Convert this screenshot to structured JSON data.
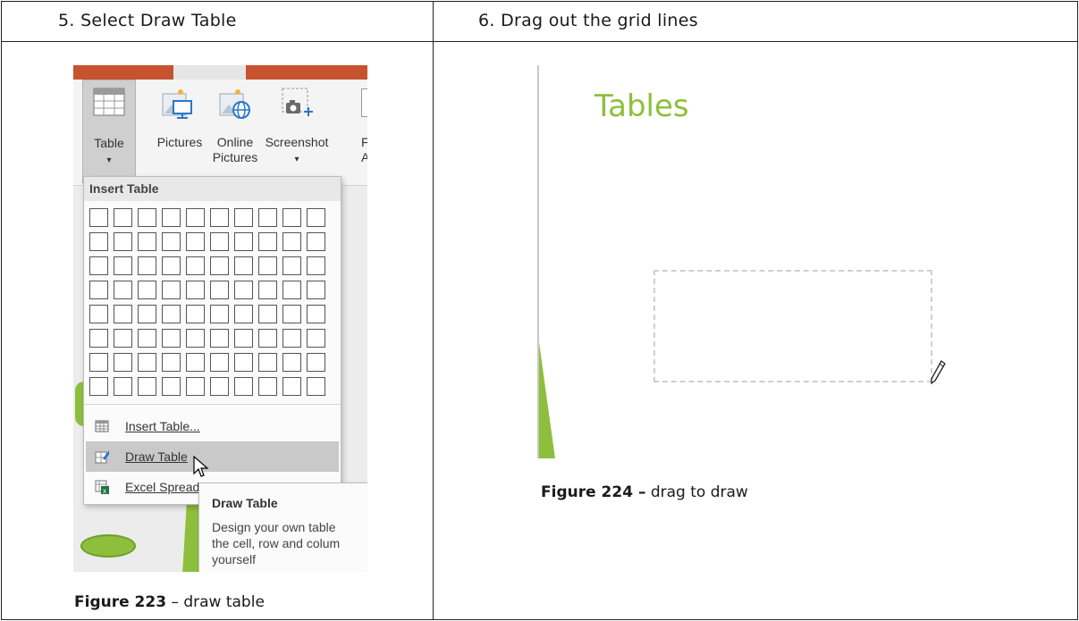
{
  "steps": [
    {
      "heading": "5. Select Draw Table",
      "caption_label": "Figure 223",
      "caption_text": " – draw table"
    },
    {
      "heading": "6. Drag out the grid lines",
      "caption_label": "Figure 224 –",
      "caption_text": " drag to draw"
    }
  ],
  "ribbon": {
    "table_label": "Table",
    "table_dropdown_glyph": "▾",
    "pictures_label": "Pictures",
    "online_pictures_label_1": "Online",
    "online_pictures_label_2": "Pictures",
    "screenshot_label": "Screenshot",
    "screenshot_dropdown_glyph": "▾",
    "cut_label_1": "F",
    "cut_label_2": "A"
  },
  "table_menu": {
    "title": "Insert Table",
    "grid_rows": 8,
    "grid_cols": 10,
    "items": [
      {
        "label": "Insert Table...",
        "icon": "table-grid-icon",
        "highlighted": false
      },
      {
        "label": "Draw Table",
        "icon": "draw-table-pencil-icon",
        "highlighted": true
      },
      {
        "label": "Excel Spreadsheet",
        "icon": "excel-icon",
        "highlighted": false
      }
    ]
  },
  "tooltip": {
    "title": "Draw Table",
    "line1": "Design your own table",
    "line2": "the cell, row and colum",
    "line3": "yourself"
  },
  "slide": {
    "title": "Tables"
  },
  "colors": {
    "tab_accent": "#c7522e",
    "slide_green": "#8dbf3d",
    "menu_highlight": "#c9c9c9"
  }
}
